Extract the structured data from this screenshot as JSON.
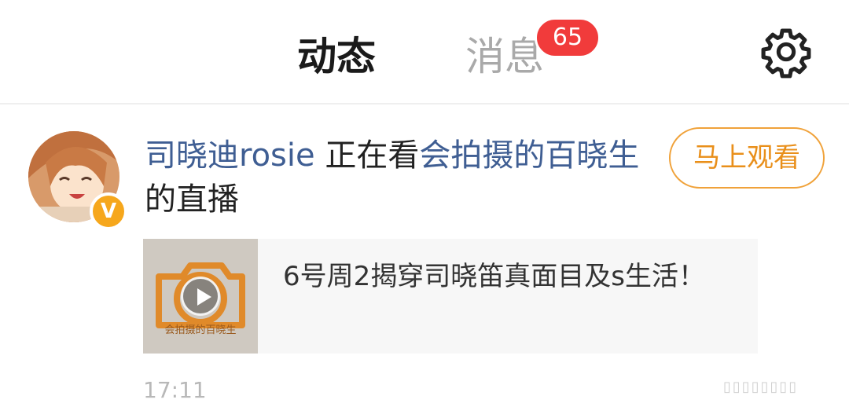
{
  "tabs": {
    "active": "动态",
    "messages": "消息",
    "messages_badge": "65"
  },
  "feed": {
    "user_name": "司晓迪rosie",
    "action": " 正在看",
    "channel": "会拍摄的百晓生",
    "suffix": " 的直播",
    "watch_button": "马上观看",
    "card_title": "6号周2揭穿司晓笛真面目及s生活！",
    "thumb_caption": "会拍摄的百晓生",
    "timestamp": "17:11"
  },
  "colors": {
    "accent_underline": "#f3a321",
    "badge": "#f13b3b",
    "link_blue": "#3f5e93",
    "button_orange": "#e98f1a"
  },
  "icons": [
    "gear-icon",
    "verified-v-icon",
    "play-icon"
  ]
}
